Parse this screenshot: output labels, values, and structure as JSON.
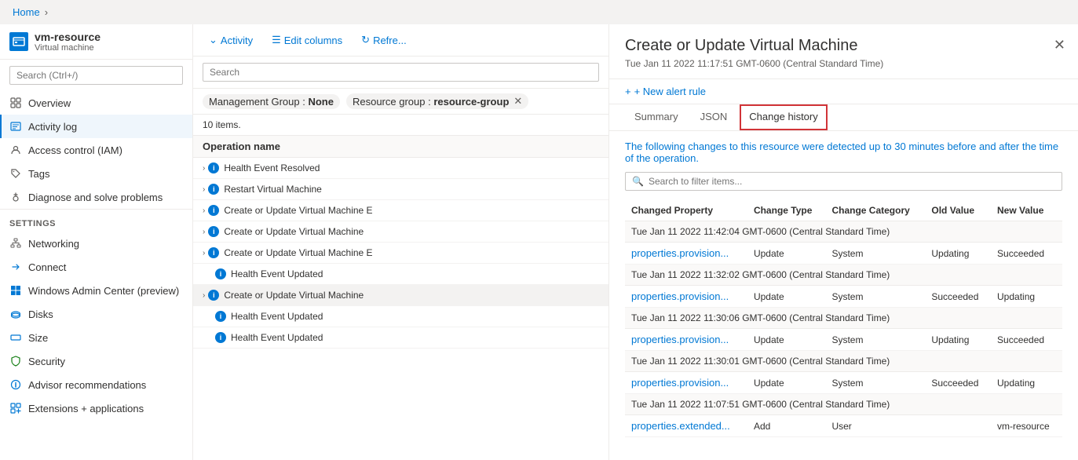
{
  "breadcrumb": {
    "items": [
      "Home"
    ]
  },
  "sidebar": {
    "resource_icon": "VM",
    "resource_name": "vm-resource",
    "resource_type": "Virtual machine",
    "search_placeholder": "Search (Ctrl+/)",
    "nav_items": [
      {
        "id": "overview",
        "label": "Overview",
        "icon": "grid"
      },
      {
        "id": "activity-log",
        "label": "Activity log",
        "icon": "list",
        "active": true
      }
    ],
    "sections": [
      {
        "title": "",
        "items": [
          {
            "id": "access-control",
            "label": "Access control (IAM)",
            "icon": "person"
          },
          {
            "id": "tags",
            "label": "Tags",
            "icon": "tag"
          },
          {
            "id": "diagnose",
            "label": "Diagnose and solve problems",
            "icon": "wrench"
          }
        ]
      },
      {
        "title": "Settings",
        "items": [
          {
            "id": "networking",
            "label": "Networking",
            "icon": "network"
          },
          {
            "id": "connect",
            "label": "Connect",
            "icon": "link"
          },
          {
            "id": "windows-admin",
            "label": "Windows Admin Center (preview)",
            "icon": "windows"
          },
          {
            "id": "disks",
            "label": "Disks",
            "icon": "disk"
          },
          {
            "id": "size",
            "label": "Size",
            "icon": "size"
          },
          {
            "id": "security",
            "label": "Security",
            "icon": "shield"
          },
          {
            "id": "advisor",
            "label": "Advisor recommendations",
            "icon": "advisor"
          },
          {
            "id": "extensions",
            "label": "Extensions + applications",
            "icon": "ext"
          }
        ]
      }
    ]
  },
  "activity_panel": {
    "toolbar": {
      "activity_label": "Activity",
      "edit_columns_label": "Edit columns",
      "refresh_label": "Refre..."
    },
    "search_placeholder": "Search",
    "filters": [
      {
        "label": "Management Group :",
        "value": "None"
      },
      {
        "label": "Resource group :",
        "value": "resource-group",
        "removable": true
      }
    ],
    "items_count": "10 items.",
    "column_header": "Operation name",
    "list_items": [
      {
        "id": 1,
        "name": "Health Event Resolved",
        "expandable": false
      },
      {
        "id": 2,
        "name": "Restart Virtual Machine",
        "expandable": false
      },
      {
        "id": 3,
        "name": "Create or Update Virtual Machine E",
        "expandable": false,
        "truncated": true
      },
      {
        "id": 4,
        "name": "Create or Update Virtual Machine",
        "expandable": false
      },
      {
        "id": 5,
        "name": "Create or Update Virtual Machine E",
        "expandable": false,
        "truncated": true
      },
      {
        "id": 6,
        "name": "Health Event Updated",
        "expandable": false,
        "no_expand": true
      },
      {
        "id": 7,
        "name": "Create or Update Virtual Machine",
        "expandable": true,
        "selected": true
      },
      {
        "id": 8,
        "name": "Health Event Updated",
        "expandable": false,
        "no_expand": true
      },
      {
        "id": 9,
        "name": "Health Event Updated",
        "expandable": false,
        "no_expand": true
      }
    ]
  },
  "detail_panel": {
    "title": "Create or Update Virtual Machine",
    "subtitle": "Tue Jan 11 2022 11:17:51 GMT-0600 (Central Standard Time)",
    "action_btn": "+ New alert rule",
    "tabs": [
      {
        "id": "summary",
        "label": "Summary"
      },
      {
        "id": "json",
        "label": "JSON"
      },
      {
        "id": "change-history",
        "label": "Change history",
        "active": true
      }
    ],
    "change_history": {
      "description_before": "The following ",
      "description_link": "changes",
      "description_after": " to this resource were detected up to 30 minutes before and after the time of the operation.",
      "search_placeholder": "Search to filter items...",
      "columns": [
        "Changed Property",
        "Change Type",
        "Change Category",
        "Old Value",
        "New Value"
      ],
      "groups": [
        {
          "date": "Tue Jan 11 2022 11:42:04 GMT-0600 (Central Standard Time)",
          "rows": [
            {
              "property": "properties.provision...",
              "change_type": "Update",
              "category": "System",
              "old_value": "Updating",
              "new_value": "Succeeded"
            }
          ]
        },
        {
          "date": "Tue Jan 11 2022 11:32:02 GMT-0600 (Central Standard Time)",
          "rows": [
            {
              "property": "properties.provision...",
              "change_type": "Update",
              "category": "System",
              "old_value": "Succeeded",
              "new_value": "Updating"
            }
          ]
        },
        {
          "date": "Tue Jan 11 2022 11:30:06 GMT-0600 (Central Standard Time)",
          "rows": [
            {
              "property": "properties.provision...",
              "change_type": "Update",
              "category": "System",
              "old_value": "Updating",
              "new_value": "Succeeded"
            }
          ]
        },
        {
          "date": "Tue Jan 11 2022 11:30:01 GMT-0600 (Central Standard Time)",
          "rows": [
            {
              "property": "properties.provision...",
              "change_type": "Update",
              "category": "System",
              "old_value": "Succeeded",
              "new_value": "Updating"
            }
          ]
        },
        {
          "date": "Tue Jan 11 2022 11:07:51 GMT-0600 (Central Standard Time)",
          "rows": [
            {
              "property": "properties.extended...",
              "change_type": "Add",
              "category": "User",
              "old_value": "",
              "new_value": "vm-resource"
            }
          ]
        }
      ]
    }
  }
}
